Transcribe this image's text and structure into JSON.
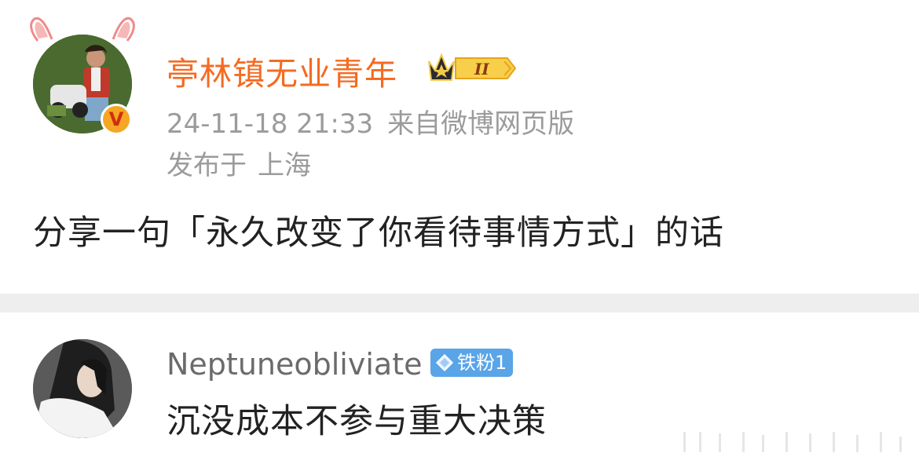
{
  "post": {
    "username": "亭林镇无业青年",
    "level_badge": "II",
    "timestamp": "24-11-18 21:33",
    "source": "来自微博网页版",
    "location_prefix": "发布于",
    "location": "上海",
    "content": "分享一句「永久改变了你看待事情方式」的话",
    "verified_mark": "V"
  },
  "comment": {
    "username": "Neptuneobliviate",
    "fan_badge": "铁粉1",
    "text": "沉没成本不参与重大决策"
  },
  "colors": {
    "username": "#f46b22",
    "meta": "#9b9b9b",
    "text": "#222222",
    "fan_badge": "#5aa4e8",
    "divider": "#eeeeee"
  }
}
